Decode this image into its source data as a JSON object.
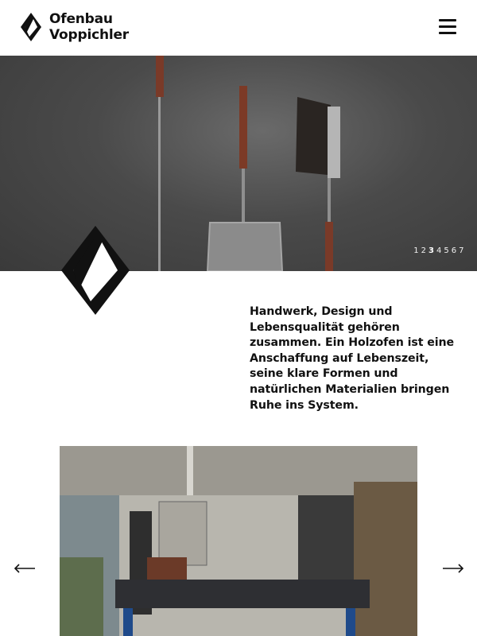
{
  "header": {
    "brand_line1": "Ofenbau",
    "brand_line2": "Voppichler",
    "logo_icon": "diamond-logo-icon",
    "menu_icon": "hamburger-menu-icon"
  },
  "hero": {
    "slides": [
      "1",
      "2",
      "3",
      "4",
      "5",
      "6",
      "7"
    ],
    "active_slide": "3"
  },
  "intro": {
    "text": "Handwerk, Design und Lebensqualität gehören zusammen. Ein Holzofen ist eine Anschaffung auf Lebenszeit, seine klare Formen und natürlichen Materialien bringen Ruhe ins System."
  },
  "gallery": {
    "prev_icon": "arrow-left-icon",
    "next_icon": "arrow-right-icon"
  },
  "colors": {
    "text": "#111111",
    "background": "#ffffff",
    "hero_wall": "#4a4a4a"
  }
}
